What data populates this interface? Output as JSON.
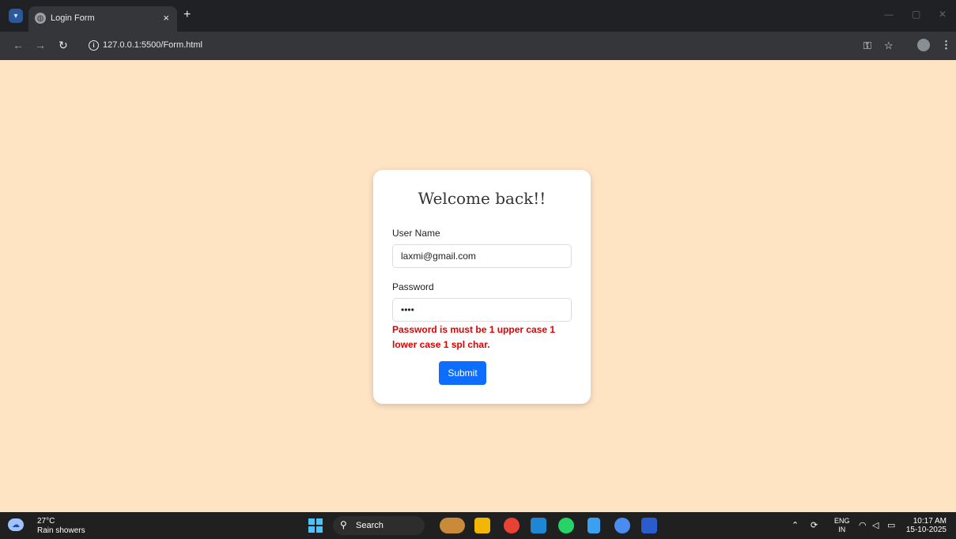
{
  "browser": {
    "tab_title": "Login Form",
    "tab_close": "×",
    "new_tab": "+",
    "url": "127.0.0.1:5500/Form.html",
    "window_minimize": "—",
    "window_restore": "▢",
    "window_close": "✕"
  },
  "form": {
    "title": "Welcome back!!",
    "username_label": "User Name",
    "username_value": "laxmi@gmail.com",
    "password_label": "Password",
    "password_value": "abcd",
    "error_message": "Password is must be 1 upper case 1 lower case 1 spl char.",
    "submit_label": "Submit"
  },
  "taskbar": {
    "weather_temp": "27°C",
    "weather_desc": "Rain showers",
    "search_label": "Search",
    "lang_top": "ENG",
    "lang_bottom": "IN",
    "time": "10:17 AM",
    "date": "15-10-2025"
  },
  "colors": {
    "page_background": "#ffe4c4",
    "submit_button": "#0d6efd",
    "error_text": "#e00000"
  }
}
